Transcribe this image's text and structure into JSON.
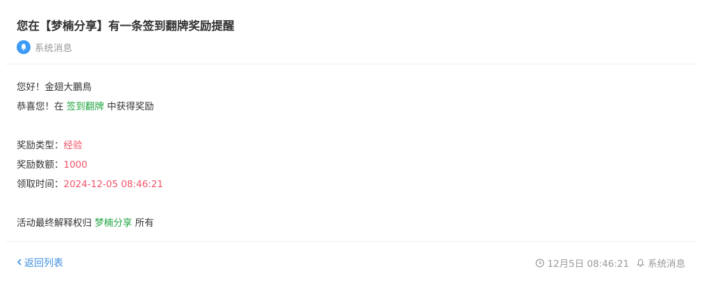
{
  "header": {
    "title": "您在【梦楠分享】有一条签到翻牌奖励提醒",
    "category": "系统消息",
    "category_icon": "bell-icon",
    "accent_color": "#3d9bf5"
  },
  "body": {
    "greeting": "您好！金翅大鵬鳥",
    "congrats_prefix": "恭喜您！在",
    "congrats_activity": "签到翻牌",
    "congrats_suffix": "中获得奖励",
    "reward_type_label": "奖励类型：",
    "reward_type_value": "经验",
    "reward_amount_label": "奖励数额：",
    "reward_amount_value": "1000",
    "claim_time_label": "领取时间：",
    "claim_time_value": "2024-12-05 08:46:21",
    "rights_prefix": "活动最终解释权归",
    "rights_site": "梦楠分享",
    "rights_suffix": "所有",
    "highlight_green": "#22a641",
    "highlight_red": "#f05369"
  },
  "footer": {
    "back_label": "返回列表",
    "back_icon": "chevron-left-icon",
    "timestamp": "12月5日 08:46:21",
    "timestamp_icon": "clock-icon",
    "category": "系统消息",
    "category_icon": "bell-icon"
  }
}
